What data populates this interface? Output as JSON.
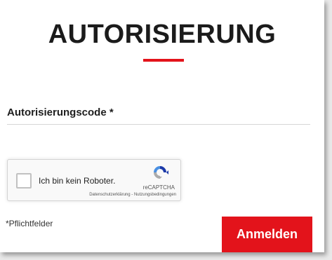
{
  "form": {
    "title": "AUTORISIERUNG",
    "code_label": "Autorisierungscode *",
    "code_value": "",
    "required_note": "*Pflichtfelder",
    "submit_label": "Anmelden"
  },
  "captcha": {
    "checkbox_label": "Ich bin kein Roboter.",
    "brand": "reCAPTCHA",
    "privacy_link": "Datenschutzerklärung",
    "separator": " - ",
    "terms_link": "Nutzungsbedingungen",
    "logo_icon": "recaptcha-logo-icon"
  },
  "colors": {
    "accent": "#e3131b",
    "title": "#1b1b1b"
  }
}
